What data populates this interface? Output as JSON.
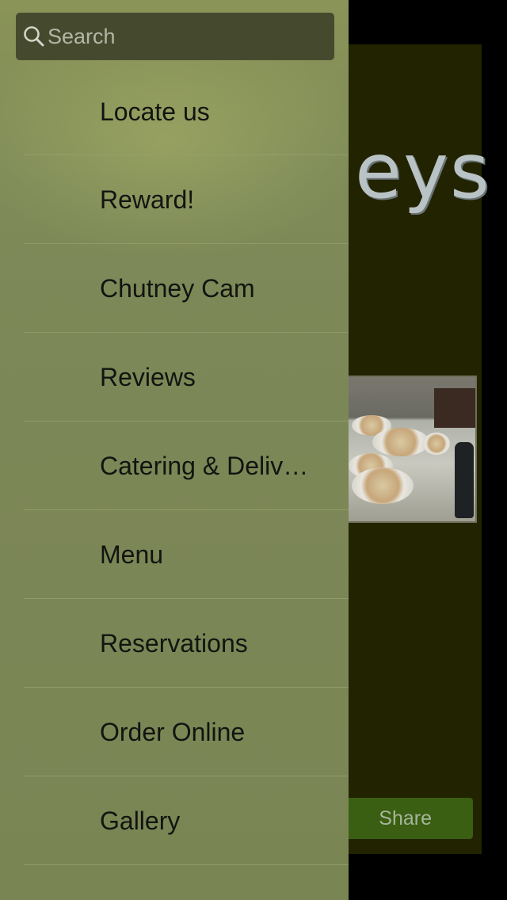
{
  "background": {
    "logo_fragment": "eys",
    "share_label": "Share"
  },
  "drawer": {
    "search": {
      "placeholder": "Search",
      "icon": "search-icon"
    },
    "items": [
      {
        "label": "Locate us"
      },
      {
        "label": "Reward!"
      },
      {
        "label": "Chutney Cam"
      },
      {
        "label": "Reviews"
      },
      {
        "label": "Catering & Delivery"
      },
      {
        "label": "Menu"
      },
      {
        "label": "Reservations"
      },
      {
        "label": "Order Online"
      },
      {
        "label": "Gallery"
      }
    ]
  },
  "colors": {
    "drawer": "#7c8757",
    "search_field": "#454a2f",
    "background_panel": "#222300",
    "share_button": "#3a5e12"
  }
}
